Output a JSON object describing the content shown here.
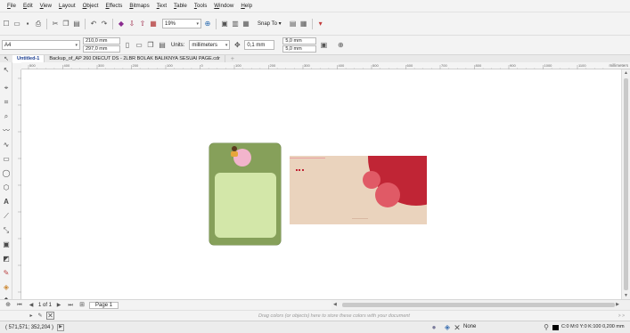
{
  "menu": [
    "File",
    "Edit",
    "View",
    "Layout",
    "Object",
    "Effects",
    "Bitmaps",
    "Text",
    "Table",
    "Tools",
    "Window",
    "Help"
  ],
  "toolbar": {
    "zoom": "19%",
    "snap_label": "Snap To"
  },
  "props": {
    "page_size": "A4",
    "width": "210,0 mm",
    "height": "297,0 mm",
    "units_label": "Units:",
    "units": "millimeters",
    "nudge": "0,1 mm",
    "dup_x": "5,0 mm",
    "dup_y": "5,0 mm"
  },
  "tabs": [
    "Untitled-1",
    "Backup_of_AP 260 DIECUT DS - 2LBR BOLAK BALIKNYA SESUAI PAGE.cdr"
  ],
  "ruler": {
    "marks": [
      "500",
      "400",
      "300",
      "200",
      "100",
      "0",
      "100",
      "200",
      "300",
      "400",
      "500",
      "600",
      "700",
      "800",
      "900",
      "1000",
      "1100"
    ],
    "unit": "millimeters"
  },
  "page_nav": {
    "counter": "1 of 1",
    "page_tab": "Page 1"
  },
  "palette_hint": "Drag colors (or objects) here to store these colors with your document",
  "status": {
    "coords": "( 571,571; 352,204 )",
    "fill": "None",
    "outline": "C:0 M:0 Y:0 K:100  0,200 mm"
  },
  "colors": {
    "green_card": "#86a05a",
    "light_green": "#d3e7a9",
    "pink": "#f2b4cc",
    "beige": "#ead3bd",
    "crimson": "#c02535",
    "rose": "#e05a66"
  }
}
